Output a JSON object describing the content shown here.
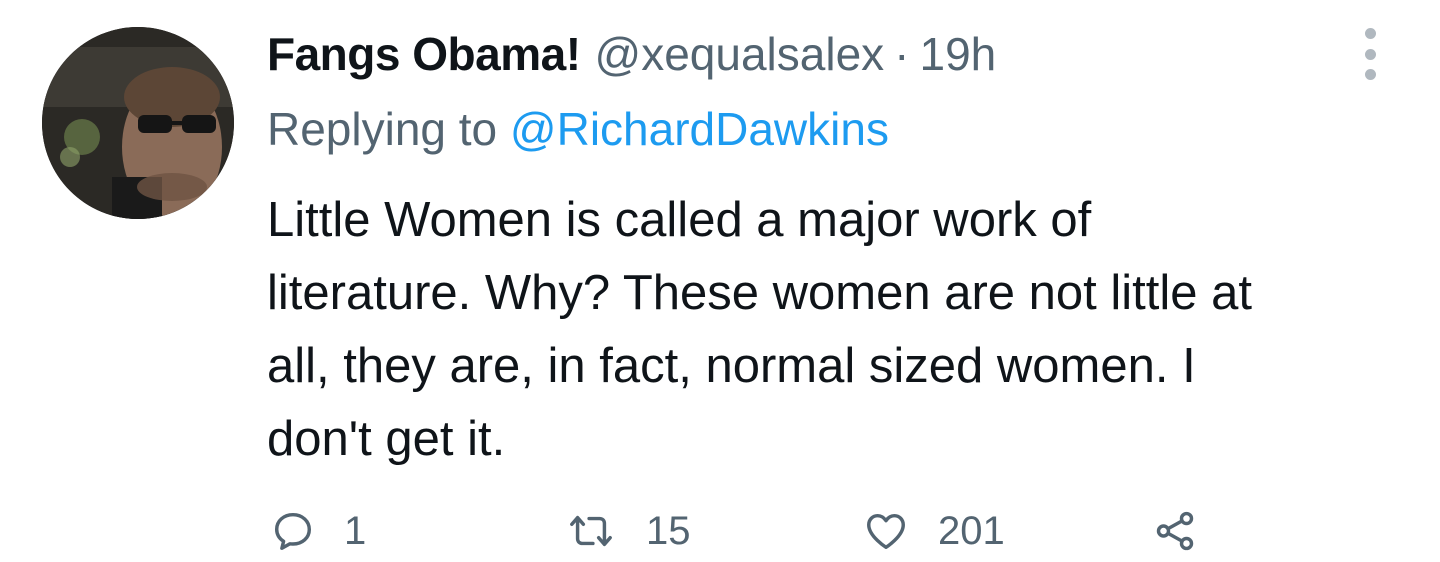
{
  "tweet": {
    "display_name": "Fangs Obama!",
    "handle": "@xequalsalex",
    "separator": "·",
    "time": "19h",
    "replying_prefix": "Replying to",
    "replying_to": "@RichardDawkins",
    "body_lines": [
      "Little Women is called a major work of",
      "literature. Why? These women are not little at",
      "all, they are, in fact, normal sized women. I",
      "don't get it."
    ],
    "stats": {
      "replies": "1",
      "retweets": "15",
      "likes": "201"
    }
  },
  "icons": {
    "more": "more-vertical-icon",
    "reply": "reply-icon",
    "retweet": "retweet-icon",
    "like": "heart-icon",
    "share": "share-icon"
  },
  "colors": {
    "text": "#0f1419",
    "secondary": "#536471",
    "link": "#1d9bf0",
    "background": "#ffffff"
  }
}
